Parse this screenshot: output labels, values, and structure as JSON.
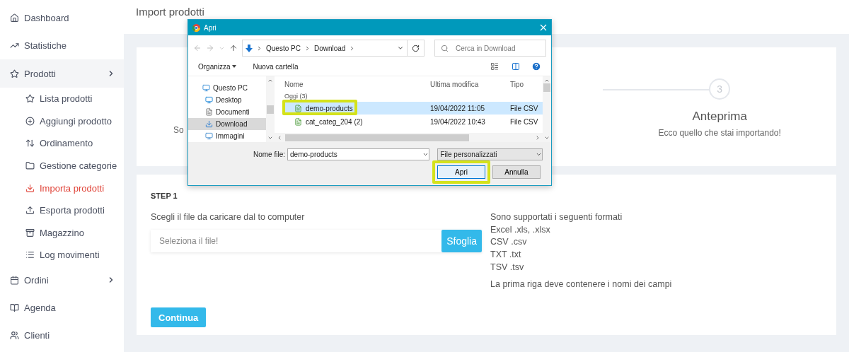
{
  "sidebar": {
    "items": [
      {
        "label": "Dashboard",
        "expanded": false
      },
      {
        "label": "Statistiche",
        "expanded": false
      },
      {
        "label": "Prodotti",
        "expanded": true,
        "expandable": true,
        "children": [
          {
            "label": "Lista prodotti",
            "selected": false
          },
          {
            "label": "Aggiungi prodotto",
            "selected": false
          },
          {
            "label": "Ordinamento",
            "selected": false
          },
          {
            "label": "Gestione categorie",
            "selected": false
          },
          {
            "label": "Importa prodotti",
            "selected": true
          },
          {
            "label": "Esporta prodotti",
            "selected": false
          },
          {
            "label": "Magazzino",
            "selected": false
          },
          {
            "label": "Log movimenti",
            "selected": false
          }
        ]
      },
      {
        "label": "Ordini",
        "expanded": false,
        "expandable": true
      },
      {
        "label": "Agenda",
        "expanded": false
      },
      {
        "label": "Clienti",
        "expanded": false
      }
    ]
  },
  "header": {
    "title": "Import prodotti"
  },
  "stepper": {
    "step_1": {
      "description": "So"
    },
    "step_3": {
      "number": "3",
      "title": "Anteprima",
      "description": "Ecco quello che stai importando!"
    }
  },
  "step_card": {
    "heading": "STEP 1",
    "prompt": "Scegli il file da caricare dal to computer",
    "file_field": {
      "placeholder": "Seleziona il file!"
    },
    "browse_button": "Sfoglia",
    "formats_title": "Sono supportati i seguenti formati",
    "formats": [
      "Excel .xls, .xlsx",
      "CSV .csv",
      "TXT .txt",
      "TSV .tsv"
    ],
    "note": "La prima riga deve contenere i nomi dei campi",
    "continue_button": "Continua"
  },
  "dialog": {
    "title": "Apri",
    "breadcrumb": [
      "Questo PC",
      "Download"
    ],
    "search": {
      "placeholder": "Cerca in Download"
    },
    "toolbar": [
      "Organizza",
      "Nuova cartella"
    ],
    "nav_pane": [
      {
        "label": "Questo PC",
        "selected": false
      },
      {
        "label": "Desktop",
        "selected": false
      },
      {
        "label": "Documenti",
        "selected": false
      },
      {
        "label": "Download",
        "selected": true
      },
      {
        "label": "Immagini",
        "selected": false
      }
    ],
    "columns": [
      "Nome",
      "Ultima modifica",
      "Tipo"
    ],
    "group": "Oggi (3)",
    "files": [
      {
        "name": "demo-products",
        "modified": "19/04/2022 11:05",
        "type": "File CSV",
        "selected": true,
        "highlighted": true
      },
      {
        "name": "cat_categ_204 (2)",
        "modified": "19/04/2022 10:43",
        "type": "File CSV",
        "selected": false,
        "highlighted": false
      }
    ],
    "filename_label": "Nome file:",
    "filename": "demo-products",
    "filter": "File personalizzati",
    "buttons": [
      {
        "label": "Apri",
        "highlighted": true
      },
      {
        "label": "Annulla",
        "highlighted": false
      }
    ]
  }
}
